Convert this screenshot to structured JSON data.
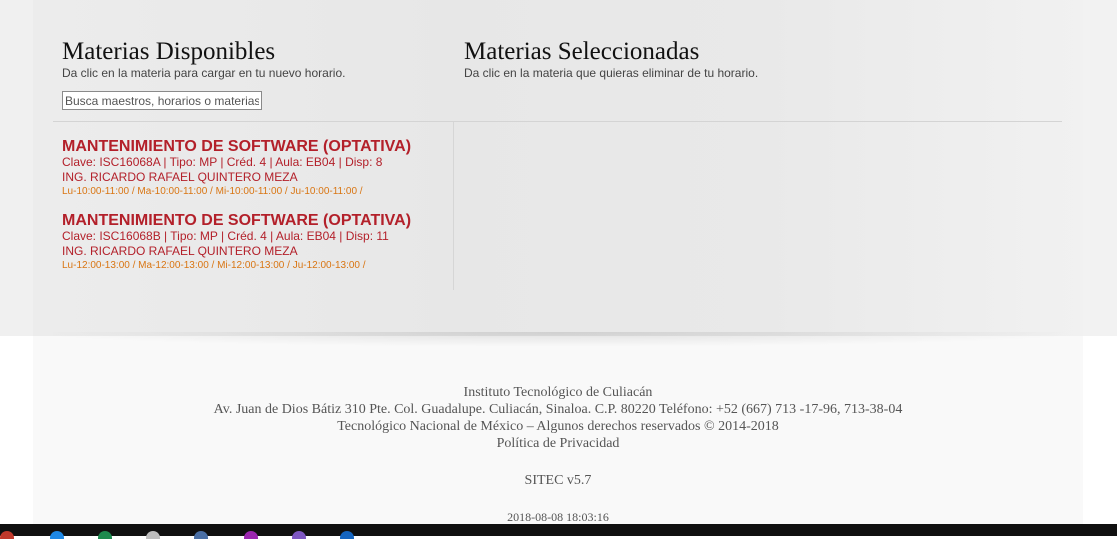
{
  "available": {
    "title": "Materias Disponibles",
    "subtitle": "Da clic en la materia para cargar en tu nuevo horario.",
    "search_placeholder": "Busca maestros, horarios o materias",
    "courses": [
      {
        "name": "MANTENIMIENTO DE SOFTWARE (OPTATIVA)",
        "details": "Clave: ISC16068A | Tipo: MP | Créd. 4 | Aula: EB04 | Disp: 8",
        "teacher": "ING. RICARDO RAFAEL QUINTERO MEZA",
        "schedule": "Lu-10:00-11:00 / Ma-10:00-11:00 / Mi-10:00-11:00 / Ju-10:00-11:00 /"
      },
      {
        "name": "MANTENIMIENTO DE SOFTWARE (OPTATIVA)",
        "details": "Clave: ISC16068B | Tipo: MP | Créd. 4 | Aula: EB04 | Disp: 11",
        "teacher": "ING. RICARDO RAFAEL QUINTERO MEZA",
        "schedule": "Lu-12:00-13:00 / Ma-12:00-13:00 / Mi-12:00-13:00 / Ju-12:00-13:00 /"
      }
    ]
  },
  "selected": {
    "title": "Materias Seleccionadas",
    "subtitle": "Da clic en la materia que quieras eliminar de tu horario."
  },
  "footer": {
    "institute": "Instituto Tecnológico de Culiacán",
    "address": "Av. Juan de Dios Bátiz 310 Pte. Col. Guadalupe. Culiacán, Sinaloa. C.P. 80220 Teléfono: +52 (667) 713 -17-96, 713-38-04",
    "rights": "Tecnológico Nacional de México – Algunos derechos reservados © 2014-2018",
    "privacy": "Política de Privacidad",
    "version": "SITEC v5.7",
    "timestamp": "2018-08-08 18:03:16"
  },
  "colors": {
    "course_name": "#b3202a",
    "schedule": "#d97512"
  },
  "taskbar": {
    "icons": [
      "app-red-icon",
      "edge-icon",
      "excel-icon",
      "file-icon",
      "shield-icon",
      "chrome-icon",
      "app-purple-icon",
      "app-blue-icon"
    ]
  }
}
